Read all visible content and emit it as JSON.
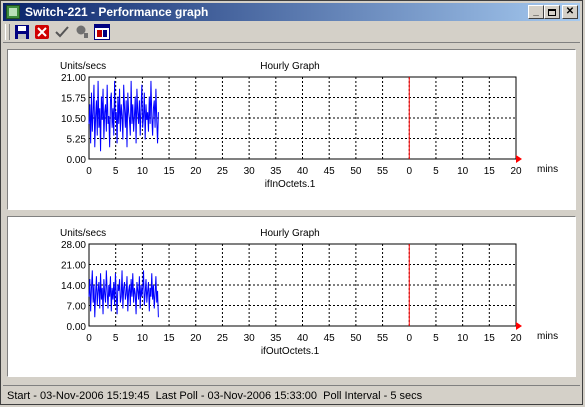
{
  "window": {
    "title": "Switch-221 - Performance graph",
    "buttons": [
      "minimize",
      "maximize",
      "close"
    ]
  },
  "toolbar": {
    "icons": [
      "save-icon",
      "delete-icon",
      "check-icon",
      "search-icon",
      "window-icon"
    ]
  },
  "graphs": [
    {
      "title": "Hourly Graph",
      "y_label": "Units/secs",
      "x_label": "ifInOctets.1",
      "x_unit": "mins",
      "y_ticks": [
        "21.00",
        "15.75",
        "10.50",
        "5.25",
        "0.00"
      ],
      "x_ticks": [
        "0",
        "5",
        "10",
        "15",
        "20",
        "25",
        "30",
        "35",
        "40",
        "45",
        "50",
        "55",
        "0",
        "5",
        "10",
        "15",
        "20"
      ]
    },
    {
      "title": "Hourly Graph",
      "y_label": "Units/secs",
      "x_label": "ifOutOctets.1",
      "x_unit": "mins",
      "y_ticks": [
        "28.00",
        "21.00",
        "14.00",
        "7.00",
        "0.00"
      ],
      "x_ticks": [
        "0",
        "5",
        "10",
        "15",
        "20",
        "25",
        "30",
        "35",
        "40",
        "45",
        "50",
        "55",
        "0",
        "5",
        "10",
        "15",
        "20"
      ]
    }
  ],
  "chart_data": [
    {
      "type": "line",
      "title": "Hourly Graph",
      "xlabel": "ifInOctets.1",
      "ylabel": "Units/secs",
      "ylim": [
        0,
        21
      ],
      "x_range_minutes": [
        0,
        13
      ],
      "series": [
        {
          "values": [
            9,
            14,
            4,
            17,
            7,
            12,
            19,
            3,
            11,
            15,
            6,
            20,
            8,
            13,
            2,
            16,
            10,
            18,
            5,
            12,
            14,
            7,
            19,
            9,
            11,
            3,
            15,
            17,
            8,
            13,
            6,
            20,
            10,
            12,
            4,
            16,
            9,
            18,
            7,
            14,
            11,
            5,
            19,
            13,
            8,
            15,
            3,
            17,
            12,
            10,
            6,
            20,
            9,
            14,
            7,
            11,
            16,
            4,
            18,
            12,
            9,
            15,
            6,
            13,
            19,
            8,
            11,
            17,
            5,
            14,
            10,
            12,
            7,
            16,
            9,
            20,
            11,
            6,
            13,
            15,
            8,
            18,
            10,
            4,
            12
          ]
        }
      ]
    },
    {
      "type": "line",
      "title": "Hourly Graph",
      "xlabel": "ifOutOctets.1",
      "ylabel": "Units/secs",
      "ylim": [
        0,
        28
      ],
      "x_range_minutes": [
        0,
        13
      ],
      "series": [
        {
          "values": [
            10,
            16,
            5,
            13,
            19,
            8,
            14,
            3,
            11,
            17,
            7,
            12,
            15,
            6,
            18,
            9,
            13,
            4,
            16,
            11,
            8,
            19,
            12,
            6,
            14,
            10,
            17,
            5,
            13,
            9,
            15,
            7,
            18,
            11,
            4,
            14,
            12,
            16,
            8,
            10,
            19,
            6,
            13,
            15,
            9,
            11,
            17,
            5,
            12,
            14,
            7,
            16,
            10,
            18,
            8,
            13,
            11,
            4,
            15,
            12,
            9,
            17,
            6,
            14,
            10,
            13,
            19,
            7,
            11,
            16,
            8,
            12,
            15,
            5,
            13,
            10,
            18,
            9,
            14,
            6,
            11,
            17,
            8,
            12,
            3
          ]
        }
      ]
    }
  ],
  "status": {
    "text": "Start - 03-Nov-2006 15:19:45  Last Poll - 03-Nov-2006 15:33:00  Poll Interval - 5 secs"
  }
}
